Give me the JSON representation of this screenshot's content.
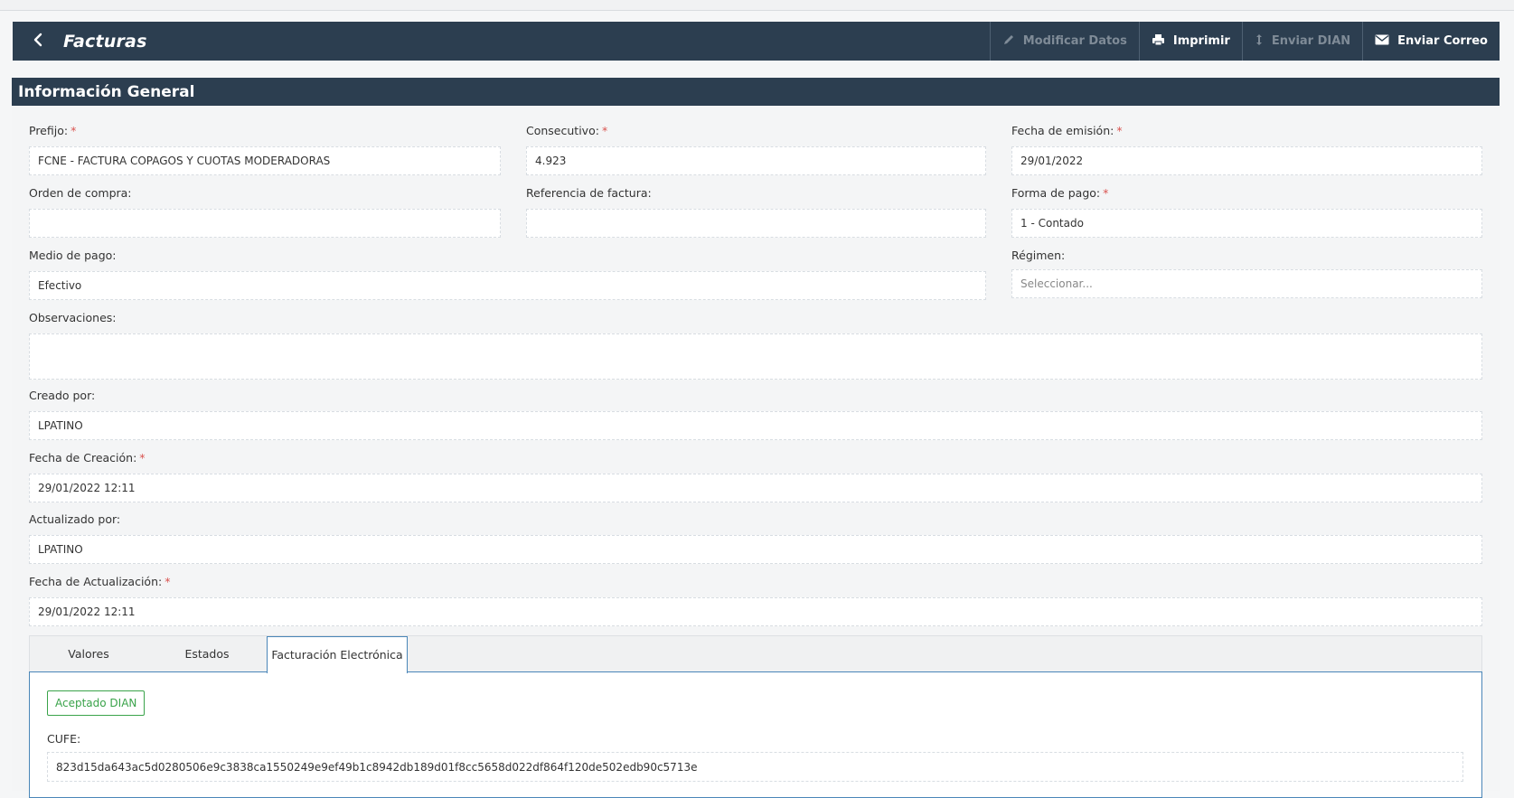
{
  "toolbar": {
    "title": "Facturas",
    "buttons": {
      "modify": "Modificar Datos",
      "print": "Imprimir",
      "send_dian": "Enviar DIAN",
      "send_mail": "Enviar Correo"
    },
    "icons": {
      "back": "chevron-left-icon",
      "modify": "pencil-icon",
      "print": "printer-icon",
      "send_dian": "arrows-vertical-icon",
      "send_mail": "envelope-icon"
    }
  },
  "section": {
    "title": "Información General"
  },
  "form": {
    "prefijo": {
      "label": "Prefijo:",
      "required": "*",
      "value": "FCNE - FACTURA COPAGOS Y CUOTAS MODERADORAS"
    },
    "consecutivo": {
      "label": "Consecutivo:",
      "required": "*",
      "value": "4.923"
    },
    "fecha_emision": {
      "label": "Fecha de emisión:",
      "required": "*",
      "value": "29/01/2022"
    },
    "orden_compra": {
      "label": "Orden de compra:",
      "value": ""
    },
    "referencia_factura": {
      "label": "Referencia de factura:",
      "value": ""
    },
    "forma_pago": {
      "label": "Forma de pago:",
      "required": "*",
      "value": "1 - Contado"
    },
    "medio_pago": {
      "label": "Medio de pago:",
      "value": "Efectivo"
    },
    "regimen": {
      "label": "Régimen:",
      "value": "",
      "placeholder": "Seleccionar..."
    },
    "observaciones": {
      "label": "Observaciones:",
      "value": ""
    },
    "creado_por": {
      "label": "Creado por:",
      "value": "LPATINO"
    },
    "fecha_creacion": {
      "label": "Fecha de Creación:",
      "required": "*",
      "value": "29/01/2022 12:11"
    },
    "actualizado_por": {
      "label": "Actualizado por:",
      "value": "LPATINO"
    },
    "fecha_actualizacion": {
      "label": "Fecha de Actualización:",
      "required": "*",
      "value": "29/01/2022 12:11"
    }
  },
  "tabs": {
    "items": [
      {
        "label": "Valores",
        "active": false
      },
      {
        "label": "Estados",
        "active": false
      },
      {
        "label": "Facturación Electrónica",
        "active": true
      }
    ]
  },
  "electronic": {
    "status_badge": "Aceptado DIAN",
    "cufe_label": "CUFE:",
    "cufe_value": "823d15da643ac5d0280506e9c3838ca1550249e9ef49b1c8942db189d01f8cc5658d022df864f120de502edb90c5713e"
  },
  "colors": {
    "header_bg": "#2c3e50",
    "required": "#d9534f",
    "accepted": "#3aa34a",
    "active_tab_border": "#4a86b8"
  }
}
